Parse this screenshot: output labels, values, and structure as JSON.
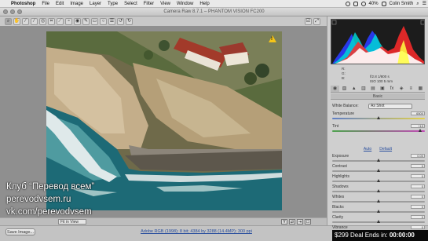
{
  "menubar": {
    "items": [
      "Photoshop",
      "File",
      "Edit",
      "Image",
      "Layer",
      "Type",
      "Select",
      "Filter",
      "View",
      "Window",
      "Help"
    ],
    "battery": "40%",
    "user": "Colin Smith"
  },
  "window": {
    "title": "Camera Raw 8.7.1  –  PHANTOM VISION FC200"
  },
  "toolbar": {
    "tools": [
      "zoom",
      "hand",
      "white-balance",
      "color-sampler",
      "targeted-adjustment",
      "crop",
      "straighten",
      "spot-removal",
      "red-eye",
      "adjustment-brush",
      "graduated-filter",
      "radial-filter",
      "preferences",
      "rotate-left",
      "rotate-right"
    ]
  },
  "preview": {
    "zoom_level": "Fit in View",
    "warning_glyph": "!"
  },
  "readout": {
    "r": "R:",
    "g": "G:",
    "b": "B:",
    "aperture": "f/2.8",
    "shutter": "1/800 s",
    "iso": "ISO 100",
    "focal": "5 mm"
  },
  "panel": {
    "header": "Basic",
    "white_balance_label": "White Balance:",
    "white_balance_value": "As Shot",
    "auto_label": "Auto",
    "default_label": "Default",
    "sliders": [
      {
        "name": "temperature",
        "label": "Temperature",
        "value": "6500",
        "level": 0.5,
        "kind": "temp"
      },
      {
        "name": "tint",
        "label": "Tint",
        "value": "+19",
        "level": 0.95,
        "kind": "tint"
      },
      {
        "name": "exposure",
        "label": "Exposure",
        "value": "0.00",
        "level": 0.5,
        "kind": ""
      },
      {
        "name": "contrast",
        "label": "Contrast",
        "value": "0",
        "level": 0.5,
        "kind": ""
      },
      {
        "name": "highlights",
        "label": "Highlights",
        "value": "0",
        "level": 0.5,
        "kind": ""
      },
      {
        "name": "shadows",
        "label": "Shadows",
        "value": "0",
        "level": 0.5,
        "kind": ""
      },
      {
        "name": "whites",
        "label": "Whites",
        "value": "0",
        "level": 0.5,
        "kind": ""
      },
      {
        "name": "blacks",
        "label": "Blacks",
        "value": "0",
        "level": 0.5,
        "kind": ""
      },
      {
        "name": "clarity",
        "label": "Clarity",
        "value": "0",
        "level": 0.5,
        "kind": ""
      },
      {
        "name": "vibrance",
        "label": "Vibrance",
        "value": "0",
        "level": 0.5,
        "kind": ""
      }
    ]
  },
  "bottom": {
    "save_label": "Save Image...",
    "workflow_text": "Adobe RGB (1998); 8 bit; 4384 by 3288 (14.4MP); 300 ppi"
  },
  "watermark": {
    "line1": "Клуб “Перевод всем”",
    "line2": "perevodvsem.ru",
    "line3": "vk.com/perevodvsem"
  },
  "deal": {
    "label": "$299 Deal Ends in:",
    "countdown": "00:00:00"
  }
}
